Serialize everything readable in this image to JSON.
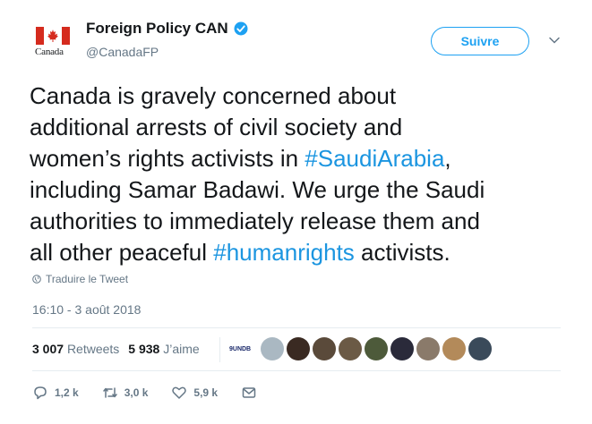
{
  "account": {
    "name": "Foreign Policy CAN",
    "handle": "@CanadaFP",
    "wordmark": "Canada"
  },
  "follow_label": "Suivre",
  "tweet": {
    "line1": "Canada is gravely concerned about",
    "line2": "additional arrests of civil society and",
    "line3_pre": "women’s rights activists in ",
    "hashtag1": "#SaudiArabia",
    "line3_post": ",",
    "line4": "including Samar Badawi. We urge the Saudi",
    "line5": "authorities to immediately release them and",
    "line6_pre": "all other peaceful ",
    "hashtag2": "#humanrights",
    "line6_post": " activists."
  },
  "translate_label": "Traduire le Tweet",
  "timestamp": "16:10 - 3 août 2018",
  "stats": {
    "retweets_count": "3 007",
    "retweets_label": "Retweets",
    "likes_count": "5 938",
    "likes_label": "J’aime"
  },
  "liker_logo_text": "9UNDB",
  "likers": [
    {
      "icon": "avatar-gray",
      "color": "#aab8c2"
    },
    {
      "icon": "avatar",
      "color": "#3a2a22"
    },
    {
      "icon": "avatar",
      "color": "#5a4a3a"
    },
    {
      "icon": "avatar",
      "color": "#6b5a45"
    },
    {
      "icon": "avatar",
      "color": "#4d5a3a"
    },
    {
      "icon": "avatar",
      "color": "#2a2a3a"
    },
    {
      "icon": "avatar",
      "color": "#8a7a6a"
    },
    {
      "icon": "avatar",
      "color": "#b38a5a"
    },
    {
      "icon": "avatar",
      "color": "#3a4a5a"
    }
  ],
  "actions": {
    "replies": "1,2 k",
    "retweets": "3,0 k",
    "likes": "5,9 k"
  },
  "colors": {
    "accent": "#1da1f2",
    "hashtag": "#1b95e0",
    "secondary_text": "#657786",
    "flag_red": "#d52b1e"
  }
}
